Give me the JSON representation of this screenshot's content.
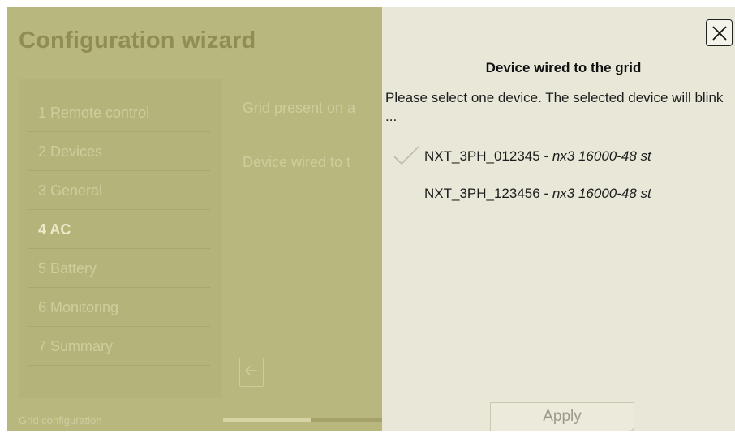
{
  "wizard": {
    "title": "Configuration wizard",
    "steps": [
      {
        "label": "1 Remote control",
        "active": false
      },
      {
        "label": "2 Devices",
        "active": false
      },
      {
        "label": "3 General",
        "active": false
      },
      {
        "label": "4 AC",
        "active": true
      },
      {
        "label": "5 Battery",
        "active": false
      },
      {
        "label": "6 Monitoring",
        "active": false
      },
      {
        "label": "7 Summary",
        "active": false
      }
    ],
    "fields": {
      "grid_present_label": "Grid present on a",
      "device_wired_label": "Device wired to t"
    },
    "back_button_icon": "arrow-left-icon",
    "status_text": "Grid configuration",
    "progress": 0.55
  },
  "dialog": {
    "title": "Device wired to the grid",
    "instructions": "Please select one device. The selected device will blink ...",
    "devices": [
      {
        "name": "NXT_3PH_012345",
        "separator": " - ",
        "model": "nx3 16000-48 st",
        "selected": true
      },
      {
        "name": "NXT_3PH_123456",
        "separator": " - ",
        "model": "nx3 16000-48 st",
        "selected": false
      }
    ],
    "apply_label": "Apply",
    "close_icon": "close-icon"
  },
  "colors": {
    "overlay": "#b8b77e",
    "dialog_bg": "#e8e7d8",
    "check": "#bdbbb0",
    "text_dark": "#1d1d1d"
  }
}
